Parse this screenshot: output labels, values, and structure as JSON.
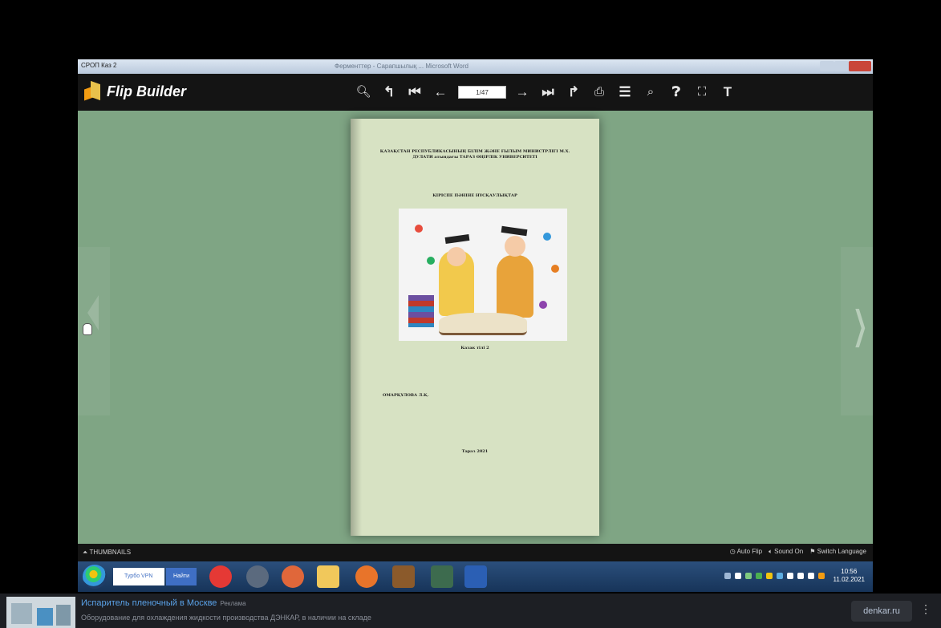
{
  "window": {
    "app_title": "СРОП Каз 2",
    "title": "Ферменттер - Сарапшылық ... Microsoft Word"
  },
  "toolbar": {
    "logo_text": "Flip Builder",
    "page_indicator": "1/47",
    "icons": [
      "zoom-in-icon",
      "back-icon",
      "first-page-icon",
      "prev-page-icon",
      "next-page-icon",
      "last-page-icon",
      "forward-icon",
      "print-icon",
      "table-of-contents-icon",
      "search-icon",
      "help-icon",
      "fullscreen-icon",
      "text-icon"
    ]
  },
  "page": {
    "university": "ҚАЗАҚСТАН РЕСПУБЛИКАСЫНЫҢ БІЛІМ ЖӘНЕ ҒЫЛЫМ МИНИСТРЛІГІ М.Х. ДУЛАТИ атындағы ТАРАЗ ӨҢІРЛІК УНИВЕРСИТЕТІ",
    "course": "КІРІСПЕ ПӘНІНЕ НҰСҚАУЛЫҚТАР",
    "lecture": "Казак тілі 2",
    "author": "ОМАРҚҰЛОВА Л.Қ.",
    "place": "Тараз 2021"
  },
  "statusbar": {
    "thumbnails": "THUMBNAILS",
    "auto_flip": "Auto Flip",
    "sound": "Sound On",
    "language": "Switch Language"
  },
  "taskbar": {
    "search_text": "Турбо VPN",
    "find_button": "Найти",
    "time": "10:56",
    "date": "11.02.2021"
  },
  "ad": {
    "title": "Испаритель пленочный в Москве",
    "badge": "Реклама",
    "description": "Оборудование для охлаждения жидкости производства ДЭНКАР, в наличии на складе",
    "domain": "denkar.ru",
    "more": "⋮"
  }
}
